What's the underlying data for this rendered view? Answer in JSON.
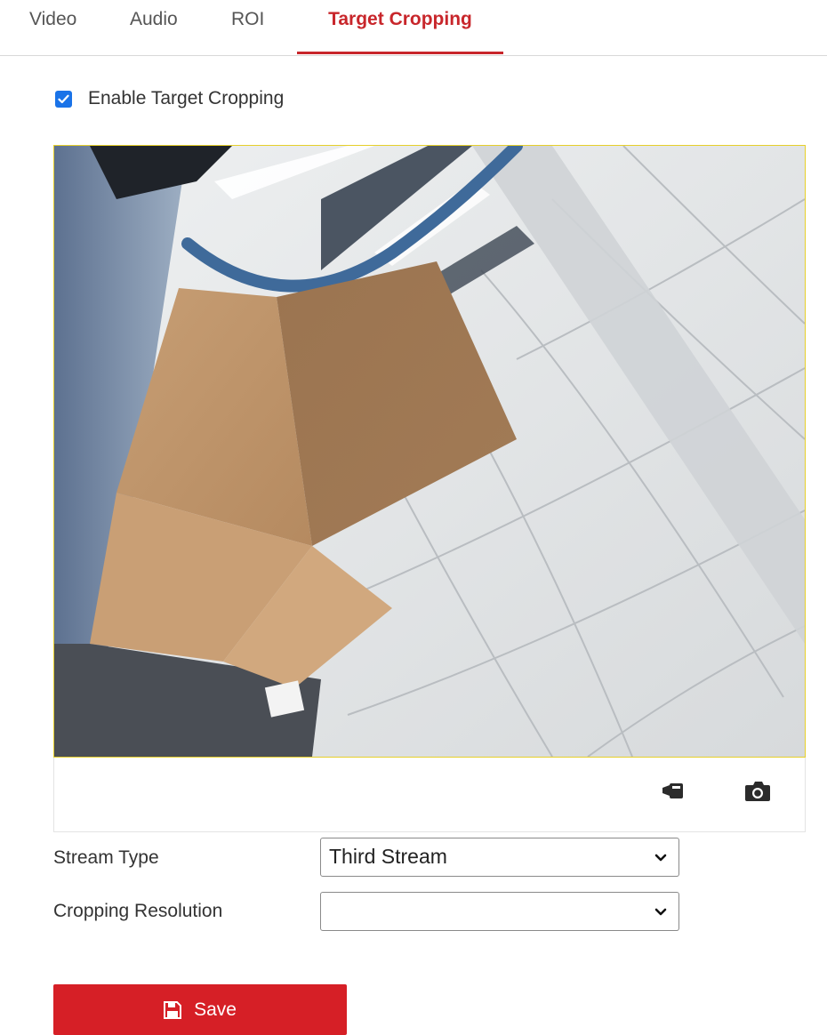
{
  "tabs": [
    {
      "label": "Video"
    },
    {
      "label": "Audio"
    },
    {
      "label": "ROI"
    },
    {
      "label": "Target Cropping",
      "active": true
    }
  ],
  "enable": {
    "label": "Enable Target Cropping",
    "checked": true
  },
  "preview": {
    "record_icon": "record-camera-icon",
    "snapshot_icon": "camera-snapshot-icon"
  },
  "form": {
    "stream_type": {
      "label": "Stream Type",
      "value": "Third Stream"
    },
    "cropping_resolution": {
      "label": "Cropping Resolution",
      "value": ""
    }
  },
  "save": {
    "label": "Save",
    "icon": "floppy-disk-icon"
  },
  "colors": {
    "accent": "#c8262b",
    "save_button": "#d61f26",
    "checkbox": "#1a73e8",
    "video_border": "#e6cf2a"
  }
}
